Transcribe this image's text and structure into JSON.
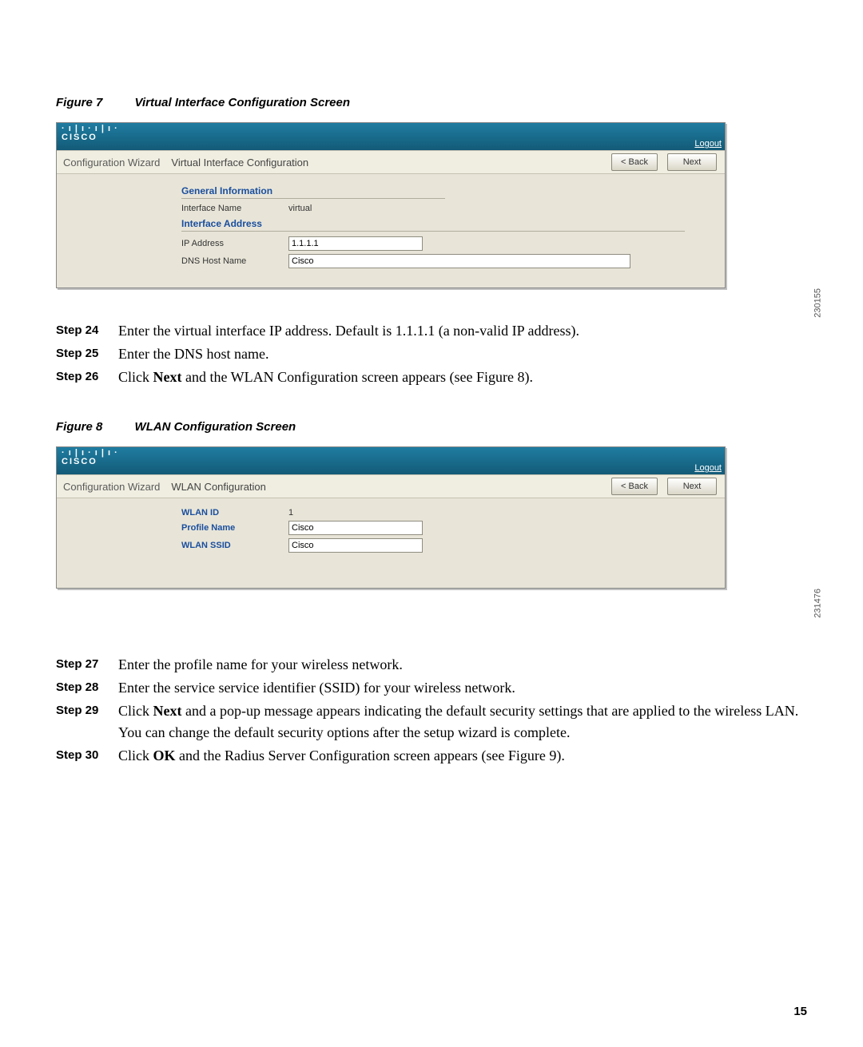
{
  "figure7": {
    "label": "Figure 7",
    "title": "Virtual Interface Configuration Screen",
    "image_id": "230155",
    "cisco_brand": "CISCO",
    "logout": "Logout",
    "breadcrumb": "Configuration Wizard",
    "page_title": "Virtual Interface Configuration",
    "back": "< Back",
    "next": "Next",
    "general_info": "General Information",
    "interface_name_label": "Interface Name",
    "interface_name_value": "virtual",
    "interface_address": "Interface Address",
    "ip_address_label": "IP Address",
    "ip_address_value": "1.1.1.1",
    "dns_label": "DNS Host Name",
    "dns_value": "Cisco"
  },
  "stepsA": [
    {
      "tag": "Step 24",
      "html": "Enter the virtual interface IP address. Default is 1.1.1.1 (a non-valid IP address)."
    },
    {
      "tag": "Step 25",
      "html": "Enter the DNS host name."
    },
    {
      "tag": "Step 26",
      "html": "Click <b class='sans'>Next</b> and the WLAN Configuration screen appears (see Figure 8)."
    }
  ],
  "figure8": {
    "label": "Figure 8",
    "title": "WLAN Configuration Screen",
    "image_id": "231476",
    "cisco_brand": "CISCO",
    "logout": "Logout",
    "breadcrumb": "Configuration Wizard",
    "page_title": "WLAN Configuration",
    "back": "< Back",
    "next": "Next",
    "wlan_id_label": "WLAN ID",
    "wlan_id_value": "1",
    "profile_label": "Profile Name",
    "profile_value": "Cisco",
    "ssid_label": "WLAN SSID",
    "ssid_value": "Cisco"
  },
  "stepsB": [
    {
      "tag": "Step 27",
      "html": "Enter the profile name for your wireless network."
    },
    {
      "tag": "Step 28",
      "html": "Enter the service service identifier (SSID) for your wireless network."
    },
    {
      "tag": "Step 29",
      "html": "Click <b class='sans'>Next</b> and a pop-up message appears indicating the default security settings that are applied to the wireless LAN. You can change the default security options after the setup wizard is complete."
    },
    {
      "tag": "Step 30",
      "html": "Click <b class='sans'>OK</b> and the Radius Server Configuration screen appears (see Figure 9)."
    }
  ],
  "page_number": "15"
}
